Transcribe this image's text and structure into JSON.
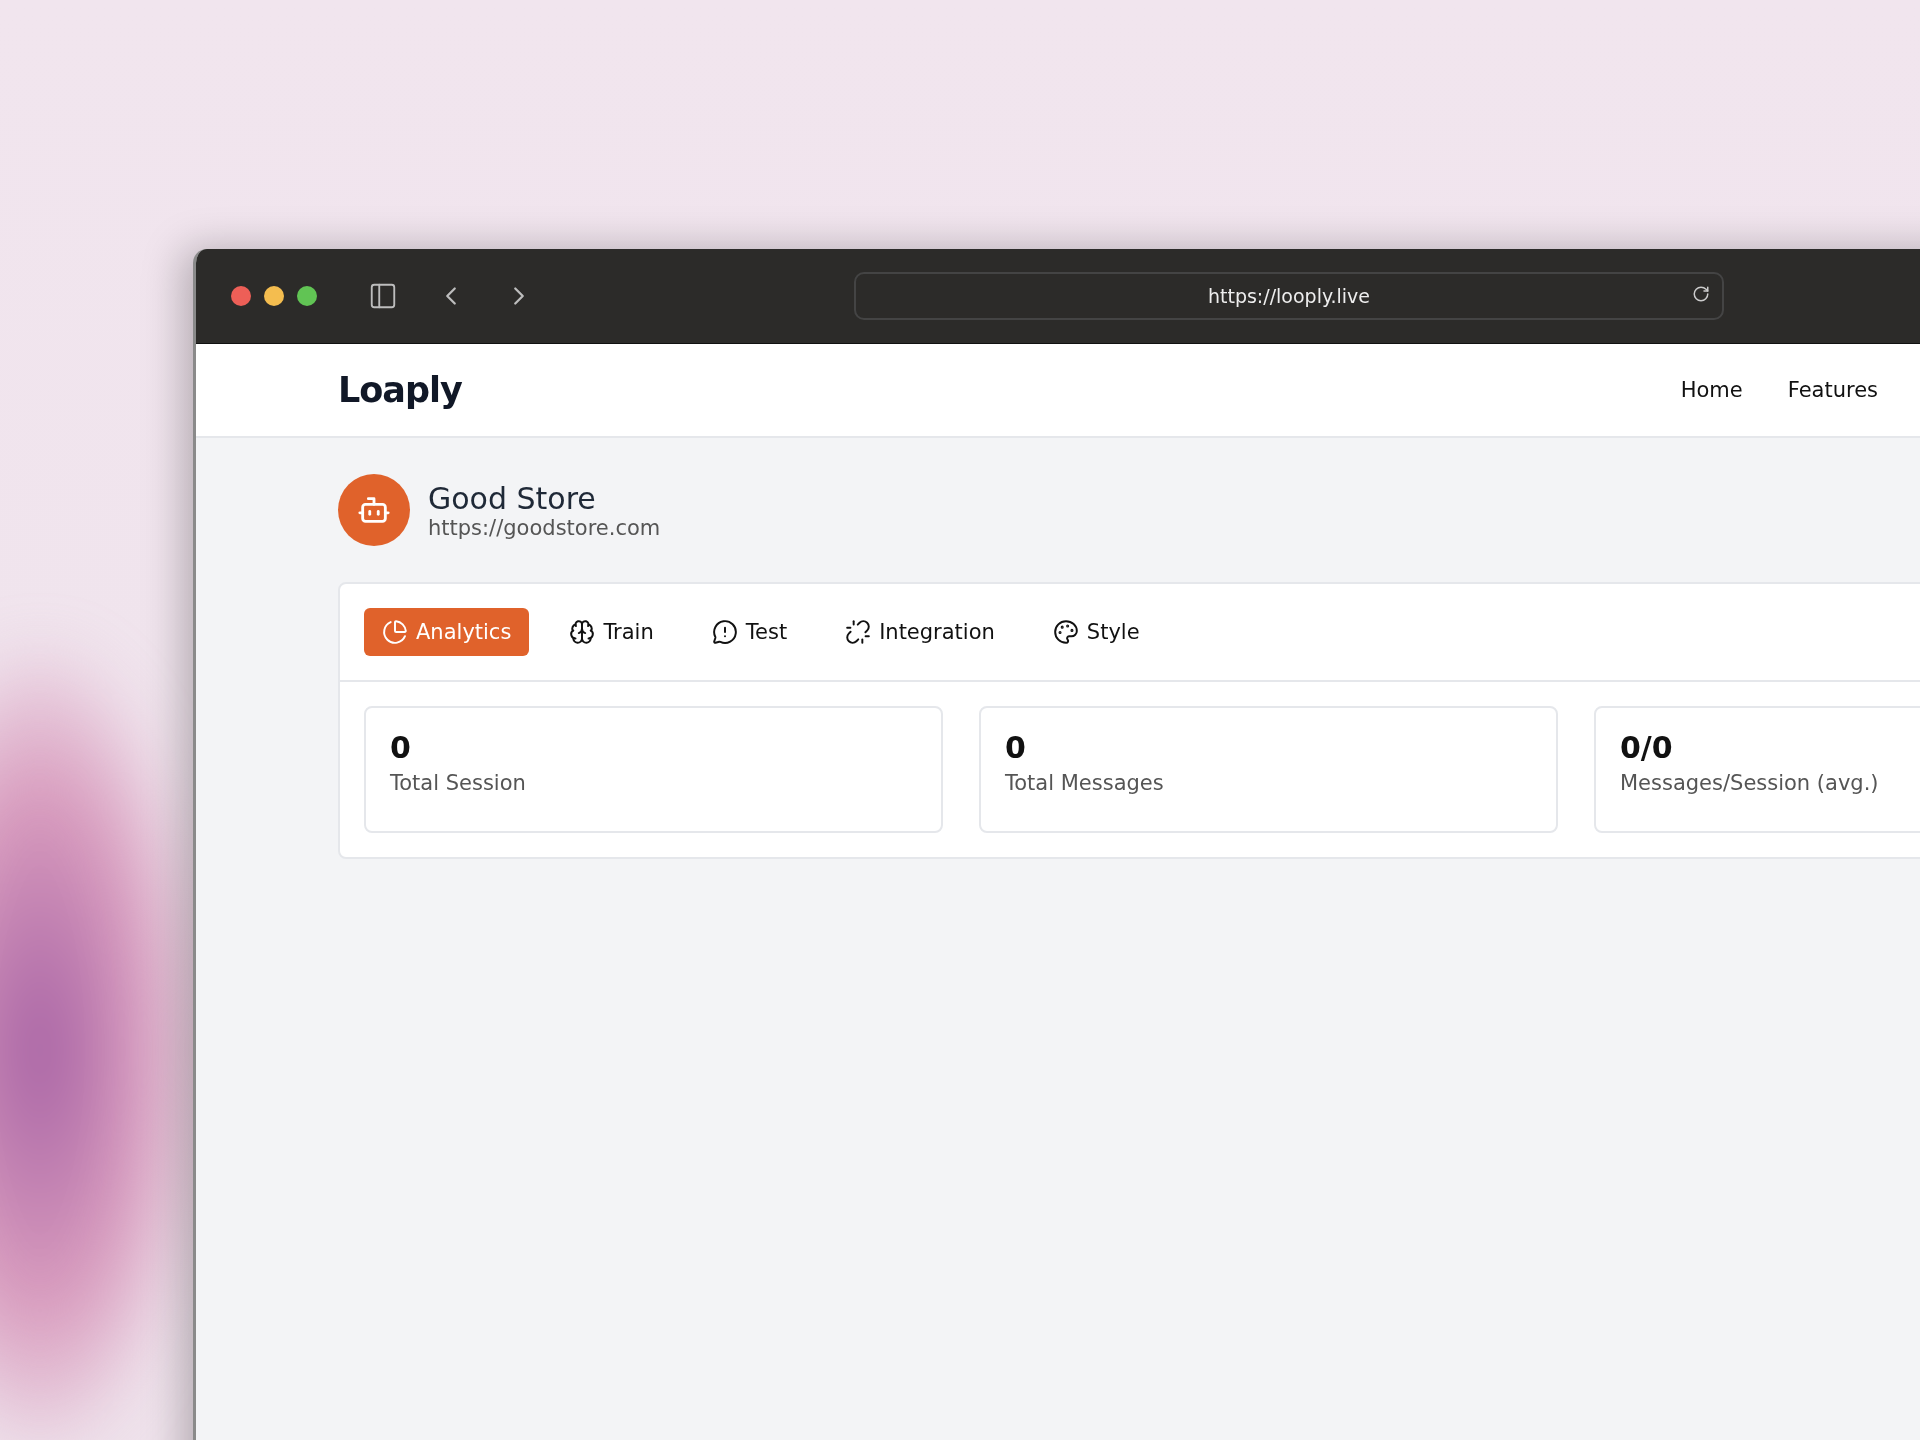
{
  "browser": {
    "url": "https://looply.live"
  },
  "header": {
    "logo": "Loaply",
    "nav": [
      "Home",
      "Features"
    ]
  },
  "store": {
    "name": "Good Store",
    "url": "https://goodstore.com"
  },
  "tabs": [
    {
      "label": "Analytics",
      "kind": "pie",
      "selected": true
    },
    {
      "label": "Train",
      "kind": "brain",
      "selected": false
    },
    {
      "label": "Test",
      "kind": "alert",
      "selected": false
    },
    {
      "label": "Integration",
      "kind": "link",
      "selected": false
    },
    {
      "label": "Style",
      "kind": "palette",
      "selected": false
    }
  ],
  "stats": [
    {
      "value": "0",
      "label": "Total Session"
    },
    {
      "value": "0",
      "label": "Total Messages"
    },
    {
      "value": "0/0",
      "label": "Messages/Session (avg.)"
    }
  ]
}
